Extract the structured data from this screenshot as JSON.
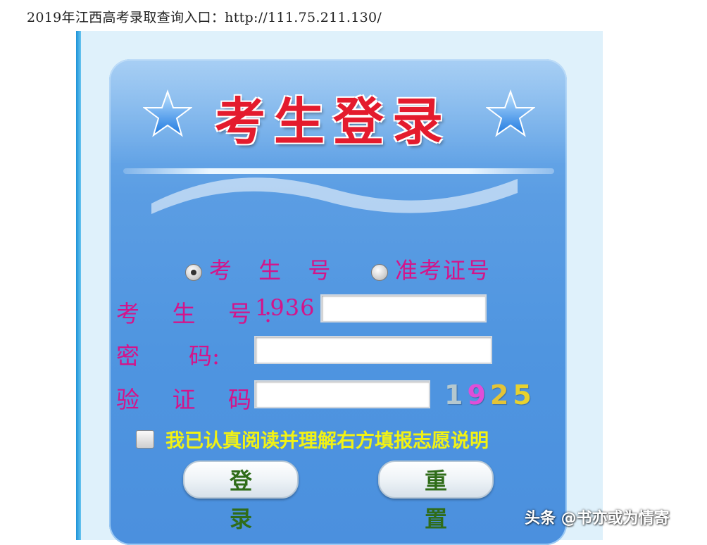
{
  "header": {
    "text": "2019年江西高考录取查询入口：http://111.75.211.130/"
  },
  "login": {
    "title": "考生登录",
    "radio_options": [
      {
        "label": "考 生 号",
        "checked": true
      },
      {
        "label": "准考证号",
        "checked": false
      }
    ],
    "fields": {
      "exam_id_label": "考 生 号:",
      "exam_id_prefix": "1936",
      "exam_id_value": "",
      "password_label_a": "密",
      "password_label_b": "码:",
      "password_value": "",
      "captcha_label": "验 证 码:",
      "captcha_value": ""
    },
    "captcha": {
      "digits": [
        "1",
        "9",
        "2",
        "5"
      ],
      "colors": [
        "#b4c8cf",
        "#e04ed8",
        "#e3c437",
        "#e8d22e"
      ]
    },
    "agreement_text": "我已认真阅读并理解右方填报志愿说明",
    "buttons": {
      "login": "登 录",
      "reset": "重 置"
    }
  },
  "watermark": "头条 @书亦或为情寄"
}
